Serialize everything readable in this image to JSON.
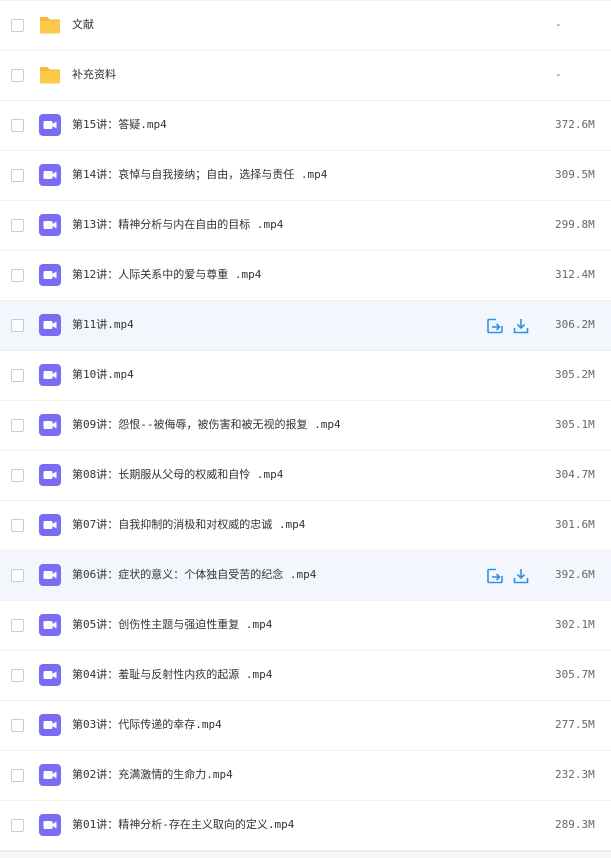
{
  "colors": {
    "folder": "#fcc94a",
    "folder_tab": "#f6b73c",
    "video": "#7b6cf6",
    "action": "#2e91e8",
    "hover_row": "#f3f7fd"
  },
  "files": [
    {
      "name": "文献",
      "size": "-",
      "type": "folder",
      "icon": "folder-icon"
    },
    {
      "name": "补充资料",
      "size": "-",
      "type": "folder",
      "icon": "folder-icon"
    },
    {
      "name": "第15讲：答疑.mp4",
      "size": "372.6M",
      "type": "video",
      "icon": "video-file-icon"
    },
    {
      "name": "第14讲：哀悼与自我接纳；自由，选择与责任 .mp4",
      "size": "309.5M",
      "type": "video",
      "icon": "video-file-icon"
    },
    {
      "name": "第13讲：精神分析与内在自由的目标 .mp4",
      "size": "299.8M",
      "type": "video",
      "icon": "video-file-icon"
    },
    {
      "name": "第12讲：人际关系中的爱与尊重 .mp4",
      "size": "312.4M",
      "type": "video",
      "icon": "video-file-icon"
    },
    {
      "name": "第11讲.mp4",
      "size": "306.2M",
      "type": "video",
      "icon": "video-file-icon",
      "hover": true
    },
    {
      "name": "第10讲.mp4",
      "size": "305.2M",
      "type": "video",
      "icon": "video-file-icon"
    },
    {
      "name": "第09讲：怨恨--被侮辱，被伤害和被无视的报复 .mp4",
      "size": "305.1M",
      "type": "video",
      "icon": "video-file-icon"
    },
    {
      "name": "第08讲：长期服从父母的权威和自怜 .mp4",
      "size": "304.7M",
      "type": "video",
      "icon": "video-file-icon"
    },
    {
      "name": "第07讲：自我抑制的消极和对权威的忠诚 .mp4",
      "size": "301.6M",
      "type": "video",
      "icon": "video-file-icon"
    },
    {
      "name": "第06讲：症状的意义：个体独自受苦的纪念 .mp4",
      "size": "392.6M",
      "type": "video",
      "icon": "video-file-icon",
      "hover": true
    },
    {
      "name": "第05讲：创伤性主题与强迫性重复 .mp4",
      "size": "302.1M",
      "type": "video",
      "icon": "video-file-icon"
    },
    {
      "name": "第04讲：羞耻与反射性内疚的起源 .mp4",
      "size": "305.7M",
      "type": "video",
      "icon": "video-file-icon"
    },
    {
      "name": "第03讲：代际传递的幸存.mp4",
      "size": "277.5M",
      "type": "video",
      "icon": "video-file-icon"
    },
    {
      "name": "第02讲：充满激情的生命力.mp4",
      "size": "232.3M",
      "type": "video",
      "icon": "video-file-icon"
    },
    {
      "name": "第01讲：精神分析-存在主义取向的定义.mp4",
      "size": "289.3M",
      "type": "video",
      "icon": "video-file-icon"
    }
  ],
  "row_actions": [
    {
      "icon": "share-icon"
    },
    {
      "icon": "download-icon"
    }
  ]
}
